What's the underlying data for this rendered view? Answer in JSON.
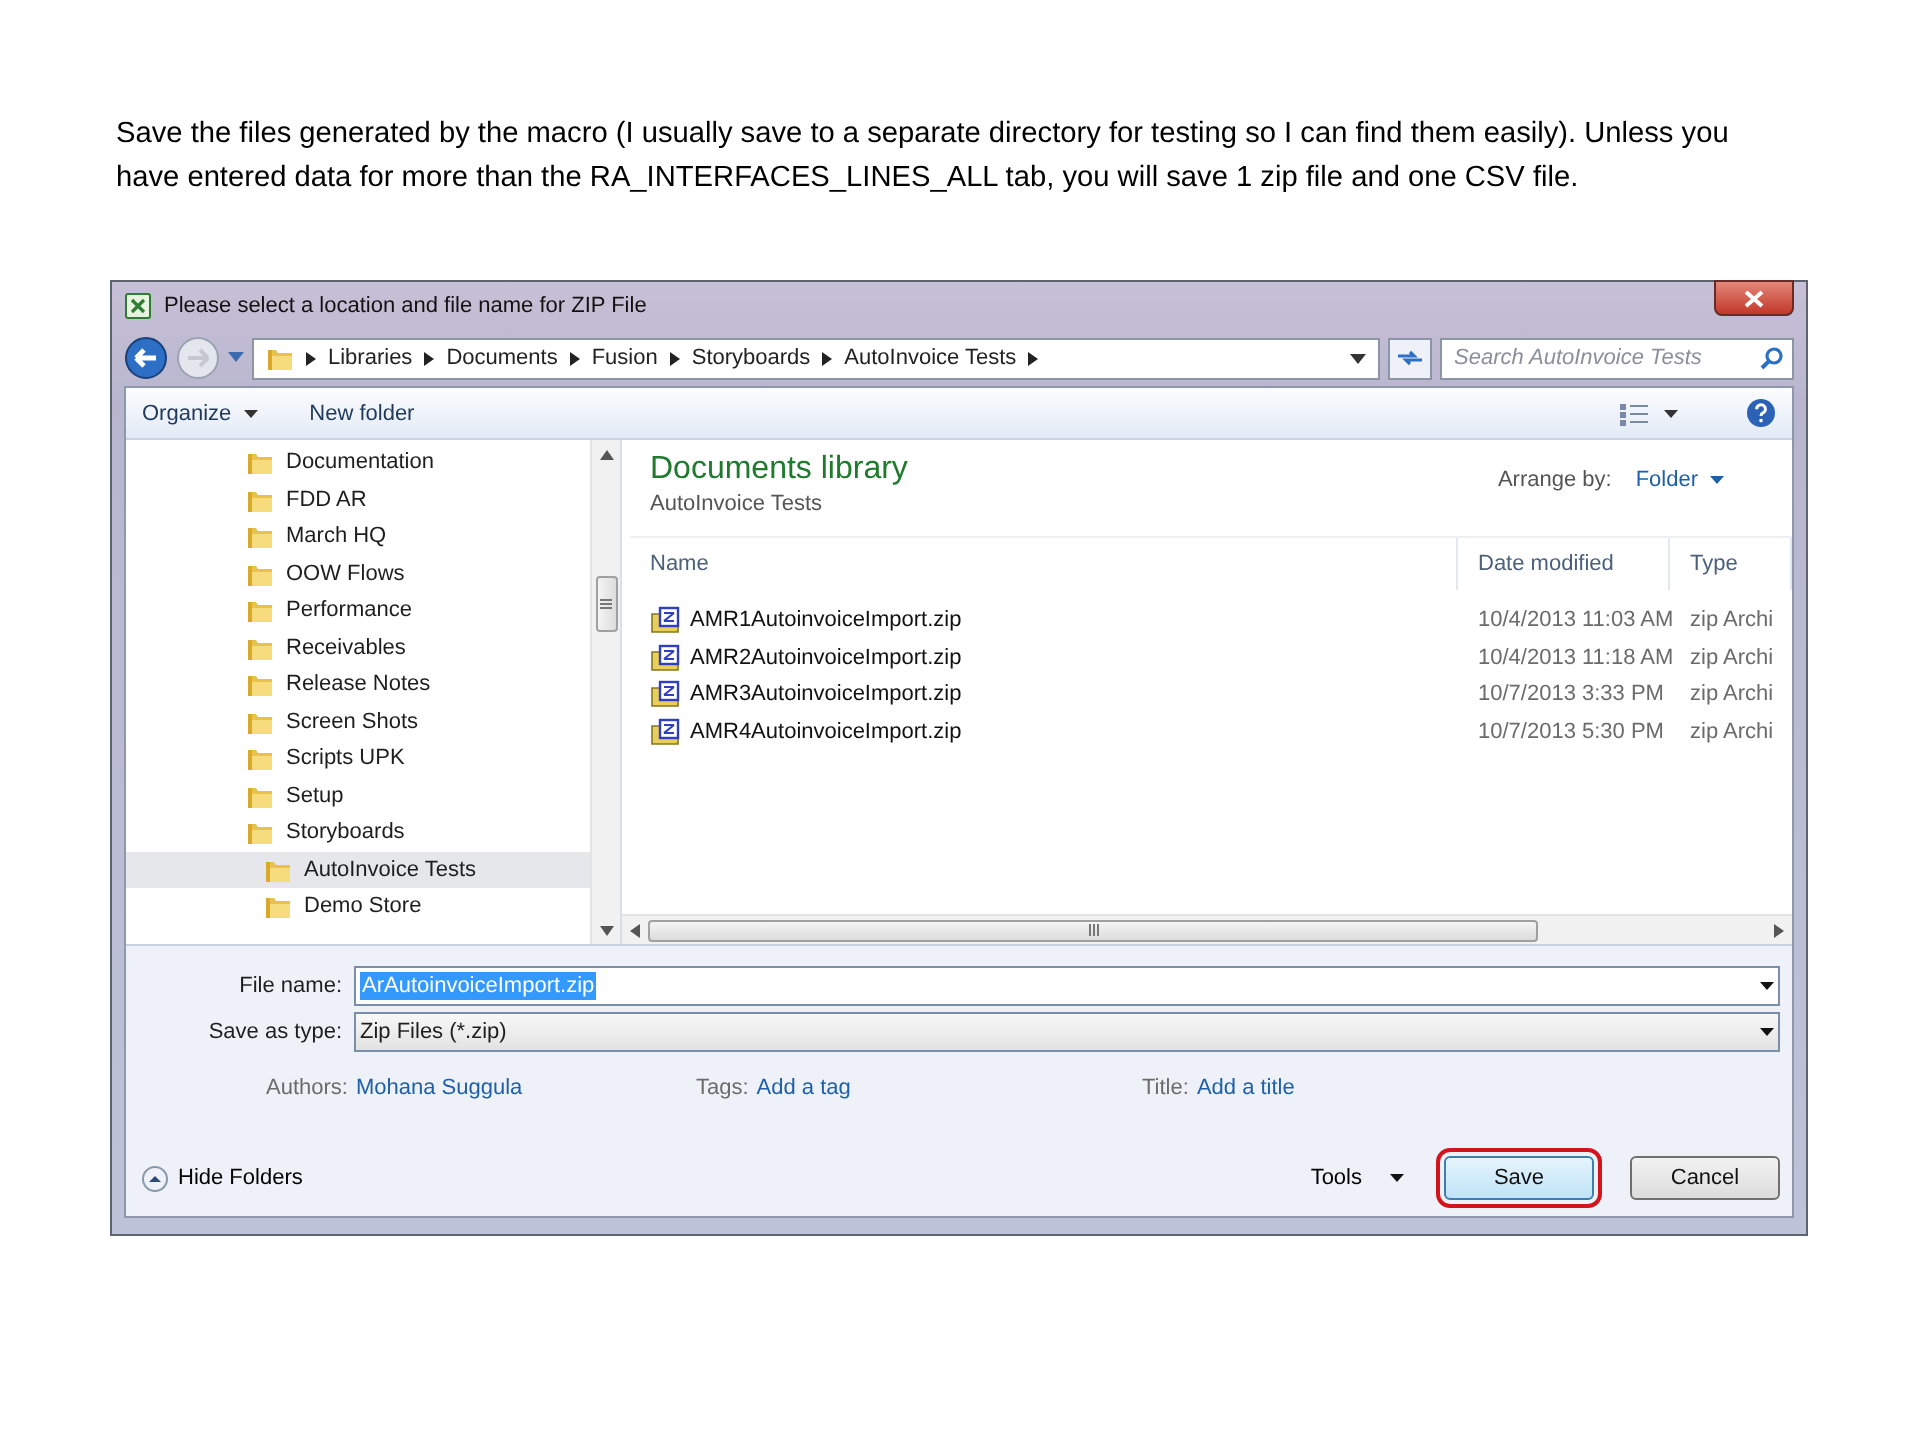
{
  "instruction": "Save the files generated by the macro (I usually save to a separate directory for testing so I can find them easily).  Unless you have entered data for more than the RA_INTERFACES_LINES_ALL tab, you will save 1 zip file and one CSV file.",
  "dialog": {
    "title": "Please select a location and file name for ZIP File",
    "breadcrumb": [
      "Libraries",
      "Documents",
      "Fusion",
      "Storyboards",
      "AutoInvoice Tests"
    ],
    "search": {
      "placeholder": "Search AutoInvoice Tests"
    },
    "toolbar": [
      "Organize",
      "New folder"
    ],
    "tree": [
      {
        "label": "Documentation",
        "selected": false
      },
      {
        "label": "FDD AR",
        "selected": false
      },
      {
        "label": "March HQ",
        "selected": false
      },
      {
        "label": "OOW Flows",
        "selected": false
      },
      {
        "label": "Performance",
        "selected": false
      },
      {
        "label": "Receivables",
        "selected": false
      },
      {
        "label": "Release Notes",
        "selected": false
      },
      {
        "label": "Screen Shots",
        "selected": false
      },
      {
        "label": "Scripts UPK",
        "selected": false
      },
      {
        "label": "Setup",
        "selected": false
      },
      {
        "label": "Storyboards",
        "selected": false,
        "children": [
          {
            "label": "AutoInvoice Tests",
            "selected": true
          },
          {
            "label": "Demo Store",
            "selected": false
          }
        ]
      }
    ],
    "library": {
      "title": "Documents library",
      "subtitle": "AutoInvoice Tests",
      "arrange_label": "Arrange by:",
      "arrange_value": "Folder"
    },
    "columns": [
      "Name",
      "Date modified",
      "Type"
    ],
    "files": [
      {
        "name": "AMR1AutoinvoiceImport.zip",
        "date": "10/4/2013 11:03 AM",
        "type": "zip Archi"
      },
      {
        "name": "AMR2AutoinvoiceImport.zip",
        "date": "10/4/2013 11:18 AM",
        "type": "zip Archi"
      },
      {
        "name": "AMR3AutoinvoiceImport.zip",
        "date": "10/7/2013 3:33 PM",
        "type": "zip Archi"
      },
      {
        "name": "AMR4AutoinvoiceImport.zip",
        "date": "10/7/2013 5:30 PM",
        "type": "zip Archi"
      }
    ],
    "file_name": {
      "label": "File name:",
      "value": "ArAutoinvoiceImport.zip"
    },
    "save_as_type": {
      "label": "Save as type:",
      "value": "Zip Files (*.zip)"
    },
    "metadata": [
      {
        "label": "Authors:",
        "value": "Mohana Suggula"
      },
      {
        "label": "Tags:",
        "value": "Add a tag"
      },
      {
        "label": "Title:",
        "value": "Add a title"
      }
    ],
    "hide_folders": "Hide Folders",
    "tools": "Tools",
    "buttons": [
      {
        "label": "Save",
        "highlighted": true
      },
      {
        "label": "Cancel",
        "highlighted": false
      }
    ]
  }
}
